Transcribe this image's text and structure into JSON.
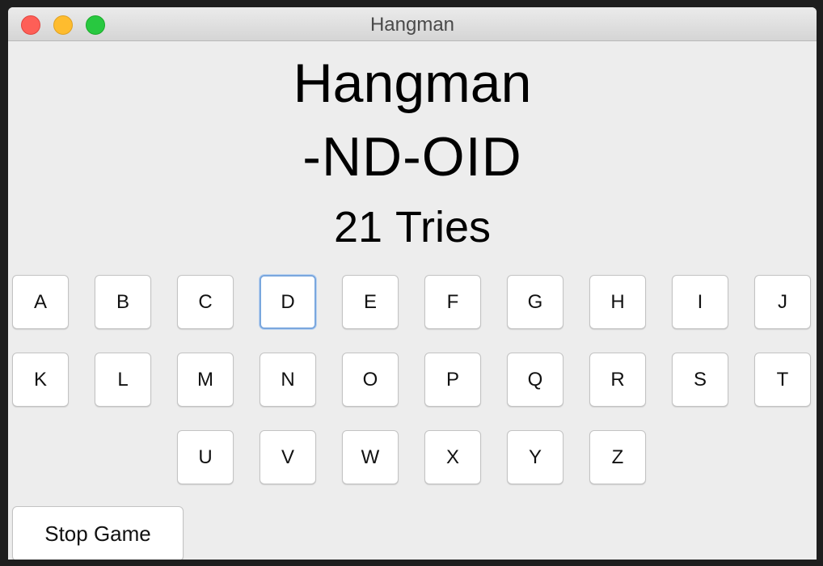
{
  "window": {
    "title": "Hangman",
    "controls": {
      "close": "close-icon",
      "minimize": "minimize-icon",
      "maximize": "maximize-icon"
    }
  },
  "game": {
    "title": "Hangman",
    "masked_word": "-ND-OID",
    "tries_count": "21",
    "tries_label": "Tries"
  },
  "keyboard": {
    "focused_letter": "D",
    "rows": [
      [
        "A",
        "B",
        "C",
        "D",
        "E",
        "F",
        "G",
        "H",
        "I",
        "J"
      ],
      [
        "K",
        "L",
        "M",
        "N",
        "O",
        "P",
        "Q",
        "R",
        "S",
        "T"
      ],
      [
        "U",
        "V",
        "W",
        "X",
        "Y",
        "Z"
      ]
    ]
  },
  "actions": {
    "stop_label": "Stop Game"
  }
}
